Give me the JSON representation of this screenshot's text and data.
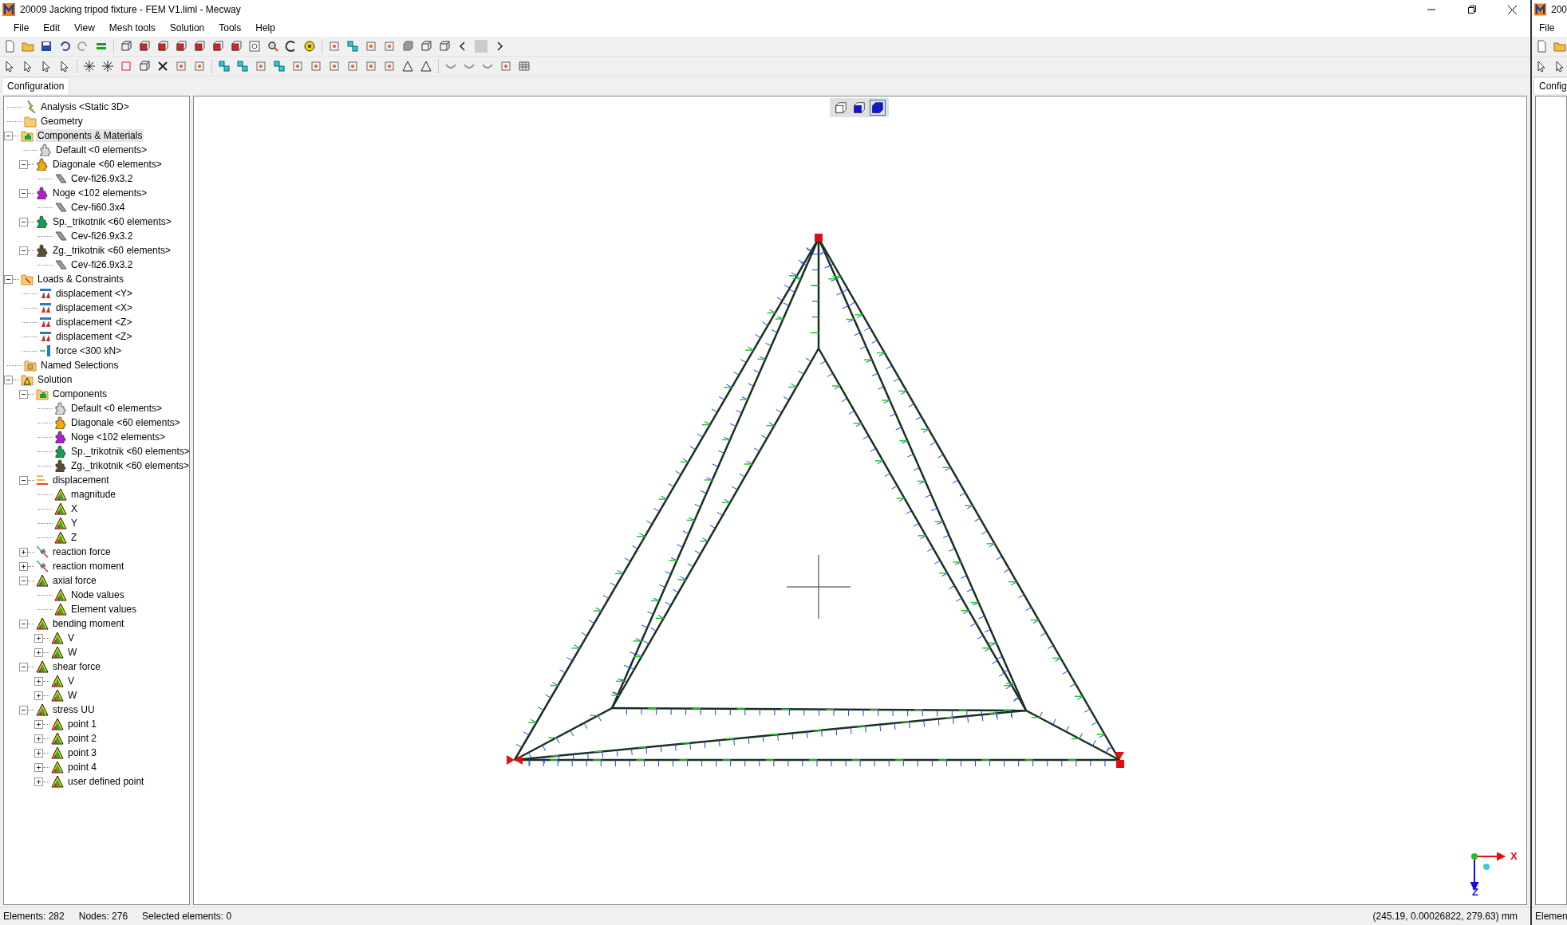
{
  "window": {
    "title": "20009 Jacking tripod fixture - FEM V1.liml - Mecway"
  },
  "menu": [
    "File",
    "Edit",
    "View",
    "Mesh tools",
    "Solution",
    "Tools",
    "Help"
  ],
  "side_tab": {
    "label": "Configuration",
    "selected": true
  },
  "tree": [
    {
      "label": "Analysis <Static 3D>",
      "kind": "analysis",
      "selected": false
    },
    {
      "label": "Geometry",
      "kind": "folder",
      "selected": false
    },
    {
      "label": "Components & Materials",
      "kind": "component-folder",
      "selected": true,
      "expanded": true,
      "children": [
        {
          "label": "Default <0 elements>",
          "kind": "component",
          "color": "#d8d8d8",
          "selected": false
        },
        {
          "label": "Diagonale <60 elements>",
          "kind": "component",
          "color": "#f5a800",
          "selected": false,
          "expanded": true,
          "children": [
            {
              "label": "Cev-fi26.9x3.2",
              "kind": "section",
              "selected": false
            }
          ]
        },
        {
          "label": "Noge <102 elements>",
          "kind": "component",
          "color": "#b020c8",
          "selected": false,
          "expanded": true,
          "children": [
            {
              "label": "Cev-fi60.3x4",
              "kind": "section",
              "selected": false
            }
          ]
        },
        {
          "label": "Sp._trikotnik <60 elements>",
          "kind": "component",
          "color": "#10a050",
          "selected": false,
          "expanded": true,
          "children": [
            {
              "label": "Cev-fi26.9x3.2",
              "kind": "section",
              "selected": false
            }
          ]
        },
        {
          "label": "Zg._trikotnik <60 elements>",
          "kind": "component",
          "color": "#5a5030",
          "selected": false,
          "expanded": true,
          "children": [
            {
              "label": "Cev-fi26.9x3.2",
              "kind": "section",
              "selected": false
            }
          ]
        }
      ]
    },
    {
      "label": "Loads & Constraints",
      "kind": "loads-folder",
      "selected": false,
      "expanded": true,
      "children": [
        {
          "label": "displacement <Y>",
          "kind": "constraint",
          "selected": false
        },
        {
          "label": "displacement <X>",
          "kind": "constraint",
          "selected": false
        },
        {
          "label": "displacement <Z>",
          "kind": "constraint",
          "selected": false
        },
        {
          "label": "displacement <Z>",
          "kind": "constraint",
          "selected": false
        },
        {
          "label": "force <300 kN>",
          "kind": "force",
          "selected": false
        }
      ]
    },
    {
      "label": "Named Selections",
      "kind": "named-folder",
      "selected": false
    },
    {
      "label": "Solution",
      "kind": "solution-folder",
      "selected": false,
      "expanded": true,
      "children": [
        {
          "label": "Components",
          "kind": "component-folder",
          "selected": false,
          "expanded": true,
          "children": [
            {
              "label": "Default <0 elements>",
              "kind": "component",
              "color": "#d8d8d8",
              "selected": false
            },
            {
              "label": "Diagonale <60 elements>",
              "kind": "component",
              "color": "#f5a800",
              "selected": false
            },
            {
              "label": "Noge <102 elements>",
              "kind": "component",
              "color": "#b020c8",
              "selected": false
            },
            {
              "label": "Sp._trikotnik <60 elements>",
              "kind": "component",
              "color": "#10a050",
              "selected": false
            },
            {
              "label": "Zg._trikotnik <60 elements>",
              "kind": "component",
              "color": "#5a5030",
              "selected": false
            }
          ]
        },
        {
          "label": "displacement",
          "kind": "displacement",
          "selected": false,
          "expanded": true,
          "children": [
            {
              "label": "magnitude",
              "kind": "result",
              "selected": false
            },
            {
              "label": "X",
              "kind": "result",
              "selected": false
            },
            {
              "label": "Y",
              "kind": "result",
              "selected": false
            },
            {
              "label": "Z",
              "kind": "result",
              "selected": false
            }
          ]
        },
        {
          "label": "reaction force",
          "kind": "reaction",
          "selected": false,
          "expanded": false
        },
        {
          "label": "reaction moment",
          "kind": "reaction",
          "selected": false,
          "expanded": false
        },
        {
          "label": "axial force",
          "kind": "result",
          "selected": false,
          "expanded": true,
          "children": [
            {
              "label": "Node values",
              "kind": "result",
              "selected": false
            },
            {
              "label": "Element values",
              "kind": "result",
              "selected": false
            }
          ]
        },
        {
          "label": "bending moment",
          "kind": "result",
          "selected": false,
          "expanded": true,
          "children": [
            {
              "label": "V",
              "kind": "result",
              "selected": false,
              "expanded": false
            },
            {
              "label": "W",
              "kind": "result",
              "selected": false,
              "expanded": false
            }
          ]
        },
        {
          "label": "shear force",
          "kind": "result",
          "selected": false,
          "expanded": true,
          "children": [
            {
              "label": "V",
              "kind": "result",
              "selected": false,
              "expanded": false
            },
            {
              "label": "W",
              "kind": "result",
              "selected": false,
              "expanded": false
            }
          ]
        },
        {
          "label": "stress UU",
          "kind": "result",
          "selected": false,
          "expanded": true,
          "children": [
            {
              "label": "point 1",
              "kind": "result",
              "selected": false,
              "expanded": false
            },
            {
              "label": "point 2",
              "kind": "result",
              "selected": false,
              "expanded": false
            },
            {
              "label": "point 3",
              "kind": "result",
              "selected": false,
              "expanded": false
            },
            {
              "label": "point 4",
              "kind": "result",
              "selected": false,
              "expanded": false
            },
            {
              "label": "user defined point",
              "kind": "result",
              "selected": false,
              "expanded": false
            }
          ]
        }
      ]
    }
  ],
  "view_buttons": [
    {
      "selected": false
    },
    {
      "selected": false
    },
    {
      "selected": true
    }
  ],
  "axes": {
    "x_label": "X",
    "z_label": "Z"
  },
  "status_bar": [
    "Elements: 282",
    "Nodes: 276",
    "Selected elements: 0"
  ],
  "coordinates": "(245.19, 0.00026822, 279.63) mm",
  "second_window": {
    "title": "200",
    "menu": "File",
    "tab": "Config",
    "status": "Elemen"
  }
}
